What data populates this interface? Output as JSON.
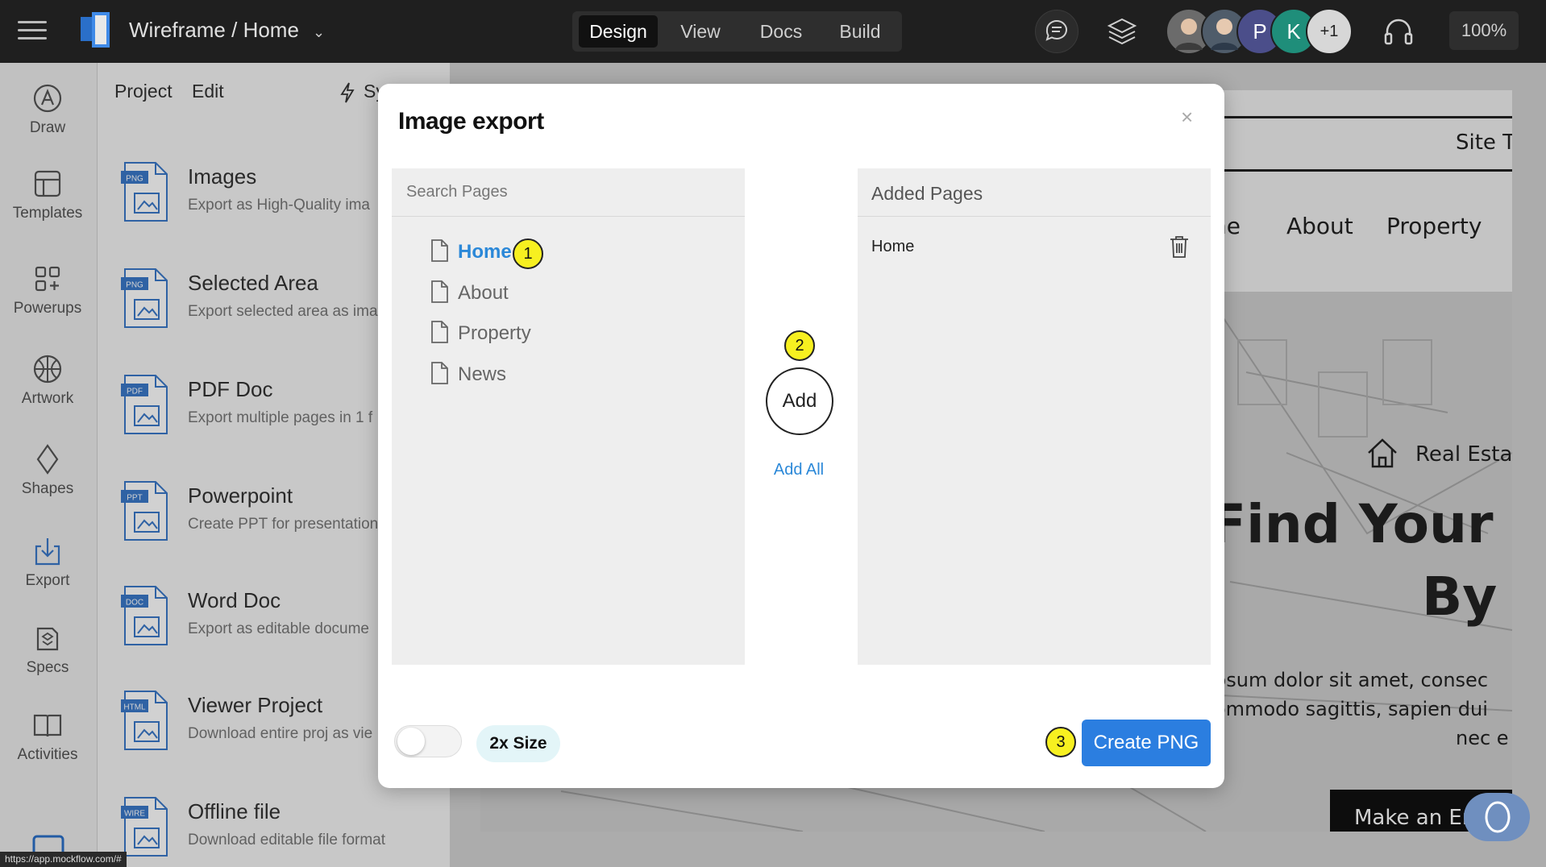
{
  "header": {
    "doc_title": "Wireframe / Home",
    "caret": "⌄",
    "modes": [
      "Design",
      "View",
      "Docs",
      "Build"
    ],
    "active_mode": "Design",
    "avatars": [
      {
        "label": "",
        "color": "#6b6b6b"
      },
      {
        "label": "",
        "color": "#4f5c6a"
      },
      {
        "label": "P",
        "color": "#4b4e8a"
      },
      {
        "label": "K",
        "color": "#1f8e7a"
      },
      {
        "label": "+1",
        "color": "#d7d7d7"
      }
    ],
    "zoom": "100%"
  },
  "leftnav": {
    "items": [
      {
        "label": "Draw",
        "icon": "draw-icon"
      },
      {
        "label": "Templates",
        "icon": "templates-icon"
      },
      {
        "label": "Powerups",
        "icon": "powerups-icon"
      },
      {
        "label": "Artwork",
        "icon": "artwork-icon"
      },
      {
        "label": "Shapes",
        "icon": "shapes-icon"
      },
      {
        "label": "Export",
        "icon": "export-icon"
      },
      {
        "label": "Specs",
        "icon": "specs-icon"
      },
      {
        "label": "Activities",
        "icon": "activities-icon"
      }
    ]
  },
  "panel": {
    "menu": [
      "Project",
      "Edit",
      "Sy"
    ],
    "export_items": [
      {
        "badge": "PNG",
        "title": "Images",
        "desc": "Export as High-Quality ima"
      },
      {
        "badge": "PNG",
        "title": "Selected Area",
        "desc": "Export selected area as ima"
      },
      {
        "badge": "PDF",
        "title": "PDF Doc",
        "desc": "Export multiple pages in 1 f"
      },
      {
        "badge": "PPT",
        "title": "Powerpoint",
        "desc": "Create PPT for presentation"
      },
      {
        "badge": "DOC",
        "title": "Word Doc",
        "desc": "Export as editable docume"
      },
      {
        "badge": "HTML",
        "title": "Viewer Project",
        "desc": "Download entire proj as vie"
      },
      {
        "badge": "WIRE",
        "title": "Offline file",
        "desc": "Download editable file format"
      }
    ]
  },
  "canvas": {
    "site_title": "Site T",
    "nav": [
      "ne",
      "About",
      "Property"
    ],
    "brand": "Real Esta",
    "headline_1": "Find Your Dr",
    "headline_2": "By",
    "body_1": "psum dolor sit amet, consec",
    "body_2": "ommodo sagittis, sapien dui",
    "body_3": "nec e",
    "cta": "Make an Enq"
  },
  "modal": {
    "title": "Image export",
    "close": "×",
    "search_placeholder": "Search Pages",
    "pages": [
      "Home",
      "About",
      "Property",
      "News"
    ],
    "selected_page": "Home",
    "add_label": "Add",
    "add_all_label": "Add All",
    "added_header": "Added Pages",
    "added_pages": [
      "Home"
    ],
    "size_label": "2x Size",
    "create_label": "Create PNG",
    "step_badges": [
      "1",
      "2",
      "3"
    ]
  },
  "status_url": "https://app.mockflow.com/#"
}
